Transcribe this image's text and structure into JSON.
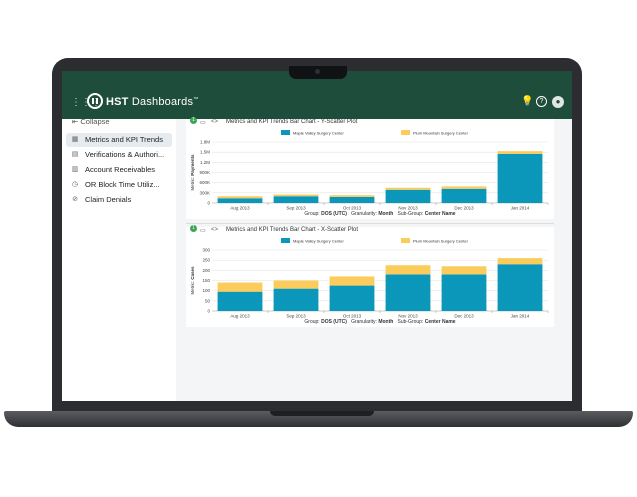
{
  "app": {
    "brand_bold": "HST",
    "brand_rest": " Dashboards",
    "trademark": "™"
  },
  "icons": {
    "grid": "grid-icon",
    "idea": "lightbulb-icon",
    "help": "help-icon",
    "user": "user-icon"
  },
  "sidebar": {
    "collapse_label": "Collapse",
    "items": [
      {
        "label": "Metrics and KPI Trends",
        "icon": "chart-icon",
        "active": true
      },
      {
        "label": "Verifications & Authori...",
        "icon": "document-icon",
        "active": false
      },
      {
        "label": "Account Receivables",
        "icon": "receipt-icon",
        "active": false
      },
      {
        "label": "OR Block Time Utiliz...",
        "icon": "clock-icon",
        "active": false
      },
      {
        "label": "Claim Denials",
        "icon": "ban-icon",
        "active": false
      }
    ]
  },
  "colors": {
    "topbar": "#1e4d3b",
    "series_maple": "#0b97b9",
    "series_plum": "#fbcb5c"
  },
  "chart_data": [
    {
      "type": "bar",
      "title": "Metrics and KPI Trends Bar Chart - Y-Scatter Plot",
      "badge": "1",
      "legend": [
        "Maple Valley Surgery Center",
        "Plum Mountain Surgery Center"
      ],
      "ylabel_prefix": "Metric:",
      "ylabel_bold": "Payments",
      "yticks": [
        "0",
        "300K",
        "600K",
        "900K",
        "1.2M",
        "1.5M",
        "1.8M"
      ],
      "ylim": [
        0,
        1800000
      ],
      "categories": [
        "Aug 2013",
        "Sep 2013",
        "Oct 2013",
        "Nov 2013",
        "Dec 2013",
        "Jan 2014"
      ],
      "series": [
        {
          "name": "Maple Valley Surgery Center",
          "values": [
            140000,
            200000,
            180000,
            390000,
            420000,
            1450000
          ]
        },
        {
          "name": "Plum Mountain Surgery Center",
          "values": [
            60000,
            50000,
            50000,
            60000,
            70000,
            80000
          ]
        }
      ],
      "footer": {
        "group_label": "Group:",
        "group_value": "DOS (UTC)",
        "gran_label": "Granularity:",
        "gran_value": "Month",
        "sub_label": "Sub-Group:",
        "sub_value": "Center Name"
      }
    },
    {
      "type": "bar",
      "title": "Metrics and KPI Trends Bar Chart - X-Scatter Plot",
      "badge": "1",
      "legend": [
        "Maple Valley Surgery Center",
        "Plum Mountain Surgery Center"
      ],
      "ylabel_prefix": "Metric:",
      "ylabel_bold": "Cases",
      "yticks": [
        "0",
        "50",
        "100",
        "150",
        "200",
        "250",
        "300"
      ],
      "ylim": [
        0,
        300
      ],
      "categories": [
        "Aug 2013",
        "Sep 2013",
        "Oct 2013",
        "Nov 2013",
        "Dec 2013",
        "Jan 2014"
      ],
      "series": [
        {
          "name": "Maple Valley Surgery Center",
          "values": [
            95,
            110,
            125,
            180,
            180,
            230
          ]
        },
        {
          "name": "Plum Mountain Surgery Center",
          "values": [
            45,
            40,
            45,
            45,
            40,
            30
          ]
        }
      ],
      "footer": {
        "group_label": "Group:",
        "group_value": "DOS (UTC)",
        "gran_label": "Granularity:",
        "gran_value": "Month",
        "sub_label": "Sub-Group:",
        "sub_value": "Center Name"
      }
    }
  ]
}
